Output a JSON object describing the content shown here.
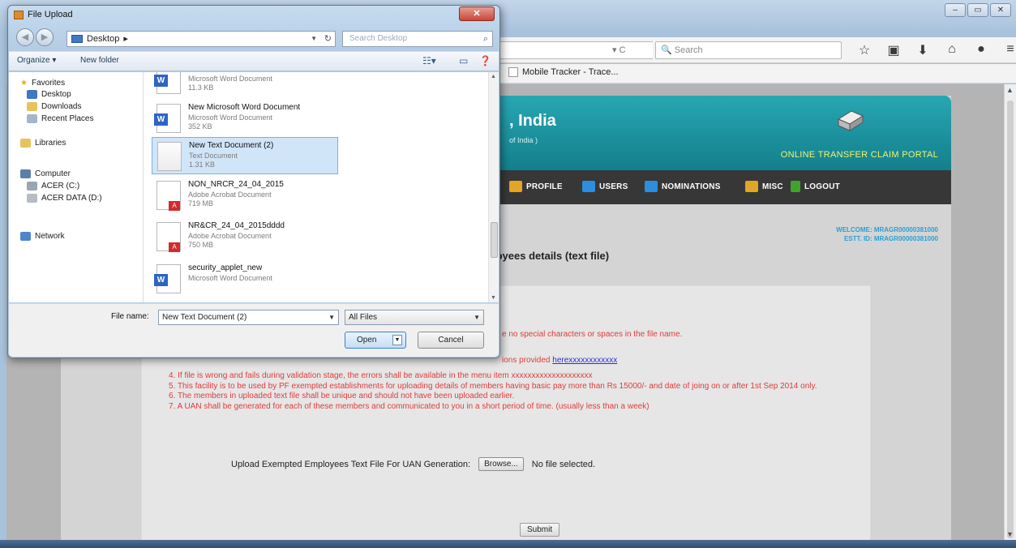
{
  "browser": {
    "search_placeholder": "Search",
    "bookmark_label": "Mobile Tracker - Trace..."
  },
  "portal": {
    "title": ", India",
    "subtitle": "of India )",
    "portal_name": "ONLINE TRANSFER CLAIM PORTAL",
    "menu": [
      "PROFILE",
      "USERS",
      "NOMINATIONS",
      "MISC",
      "LOGOUT"
    ],
    "menu_colors": [
      "#e3a524",
      "#2b8ee0",
      "#2b8ee0",
      "#e3a524",
      "#3fa52a"
    ],
    "menu_partial": "K",
    "welcome_line1": "WELCOME: MRAGR00000381000",
    "welcome_line2": "ESTT. ID: MRAGR00000381000",
    "page_title": "loyees details (text file)",
    "instructions": {
      "line_fragment1": "e no special characters or spaces in the file name.",
      "line_fragment2_text": "ions provided ",
      "line_fragment2_link": "herexxxxxxxxxxxx",
      "line4": "4. If file is wrong and fails during validation stage, the errors shall be available in the menu item xxxxxxxxxxxxxxxxxxxx",
      "line5": "5. This facility is to be used by PF exempted establishments for uploading details of members having basic pay more than Rs 15000/- and date of joing on or after 1st Sep 2014 only.",
      "line6": "6. The members in uploaded text file shall be unique and should not have been uploaded earlier.",
      "line7": "7. A UAN shall be generated for each of these members and communicated to you in a short period of time. (usually less than a week)"
    },
    "upload_label": "Upload Exempted Employees Text File For UAN Generation:",
    "browse_label": "Browse...",
    "no_file_label": "No file selected.",
    "submit_label": "Submit"
  },
  "dialog": {
    "title": "File Upload",
    "address": "Desktop",
    "search_placeholder": "Search Desktop",
    "organize": "Organize ▾",
    "new_folder": "New folder",
    "nav": {
      "favorites": "Favorites",
      "desktop": "Desktop",
      "downloads": "Downloads",
      "recent": "Recent Places",
      "libraries": "Libraries",
      "computer": "Computer",
      "drive_c": "ACER (C:)",
      "drive_d": "ACER DATA (D:)",
      "network": "Network"
    },
    "files": [
      {
        "name": "",
        "type": "Microsoft Word Document",
        "size": "11.3 KB",
        "kind": "word"
      },
      {
        "name": "New Microsoft Word Document",
        "type": "Microsoft Word Document",
        "size": "352 KB",
        "kind": "word"
      },
      {
        "name": "New Text Document (2)",
        "type": "Text Document",
        "size": "1.31 KB",
        "kind": "txt"
      },
      {
        "name": "NON_NRCR_24_04_2015",
        "type": "Adobe Acrobat Document",
        "size": "719 MB",
        "kind": "pdf"
      },
      {
        "name": "NR&CR_24_04_2015dddd",
        "type": "Adobe Acrobat Document",
        "size": "750 MB",
        "kind": "pdf"
      },
      {
        "name": "security_applet_new",
        "type": "Microsoft Word Document",
        "size": "",
        "kind": "word"
      }
    ],
    "file_name_label": "File name:",
    "file_name_value": "New Text Document (2)",
    "file_type_value": "All Files",
    "open_label": "Open",
    "cancel_label": "Cancel"
  }
}
